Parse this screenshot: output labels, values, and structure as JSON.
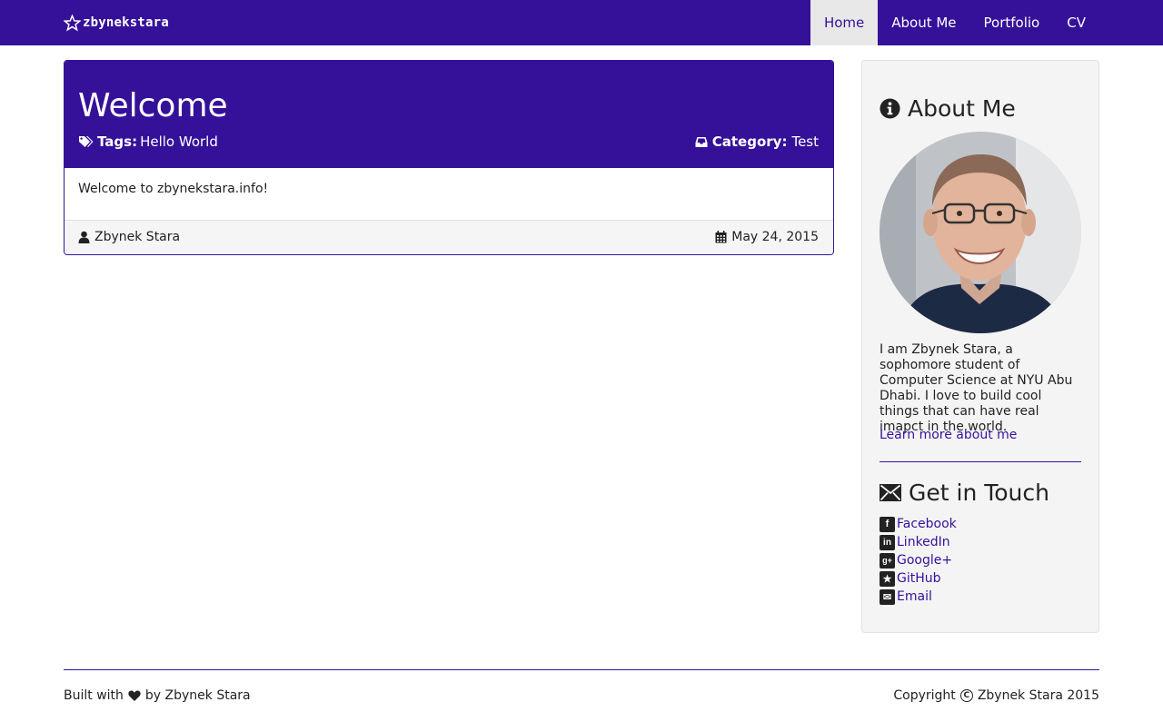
{
  "navbar": {
    "brand": "zbynekstara",
    "items": [
      {
        "label": "Home",
        "active": true
      },
      {
        "label": "About Me",
        "active": false
      },
      {
        "label": "Portfolio",
        "active": false
      },
      {
        "label": "CV",
        "active": false
      }
    ]
  },
  "post": {
    "title": "Welcome",
    "tags_label": "Tags:",
    "tags_value": "Hello World",
    "category_label": "Category:",
    "category_value": "Test",
    "body": "Welcome to zbynekstara.info!",
    "author": "Zbynek Stara",
    "date": "May 24, 2015"
  },
  "sidebar": {
    "about_title": "About Me",
    "about_text": "I am Zbynek Stara, a sophomore student of Computer Science at NYU Abu Dhabi. I love to build cool things that can have real imapct in the world.",
    "learn_more": "Learn more about me",
    "touch_title": "Get in Touch",
    "social": [
      {
        "label": "Facebook",
        "icon": "facebook-icon",
        "glyph": "f"
      },
      {
        "label": "LinkedIn",
        "icon": "linkedin-icon",
        "glyph": "in"
      },
      {
        "label": "Google+",
        "icon": "google-plus-icon",
        "glyph": "g+"
      },
      {
        "label": "GitHub",
        "icon": "github-icon",
        "glyph": "★"
      },
      {
        "label": "Email",
        "icon": "email-icon",
        "glyph": "✉"
      }
    ]
  },
  "footer": {
    "built_with": "Built with",
    "by": "by Zbynek Stara",
    "copyright": "Copyright",
    "copyright_owner": "Zbynek Stara 2015"
  },
  "colors": {
    "brand": "#351199",
    "sidebar_bg": "#f4f4f4",
    "active_nav_bg": "#e8e8e8"
  }
}
